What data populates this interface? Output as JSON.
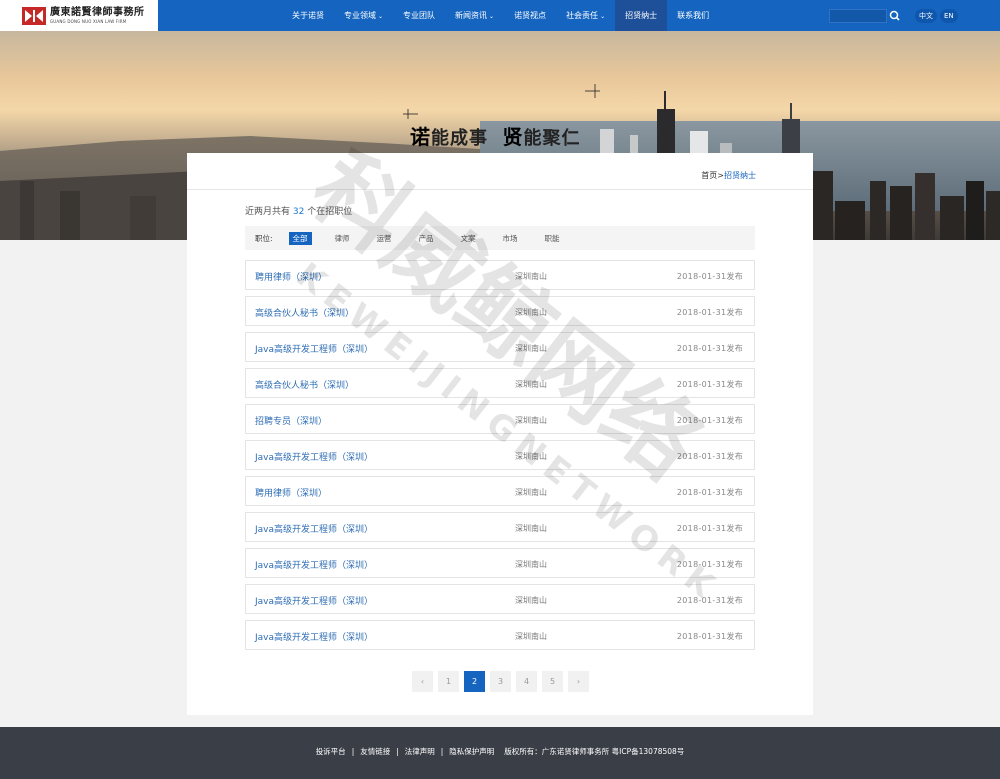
{
  "header": {
    "logo_cn": "廣東諾賢律師事務所",
    "logo_en": "GUANG DONG NUO XIAN LAW FIRM",
    "nav": [
      {
        "label": "关于诺贤",
        "caret": false,
        "active": false
      },
      {
        "label": "专业领域",
        "caret": true,
        "active": false
      },
      {
        "label": "专业团队",
        "caret": false,
        "active": false
      },
      {
        "label": "新闻资讯",
        "caret": true,
        "active": false
      },
      {
        "label": "诺贤视点",
        "caret": false,
        "active": false
      },
      {
        "label": "社会责任",
        "caret": true,
        "active": false
      },
      {
        "label": "招贤纳士",
        "caret": false,
        "active": true
      },
      {
        "label": "联系我们",
        "caret": false,
        "active": false
      }
    ],
    "lang_cn": "中文",
    "lang_en": "EN",
    "brand_color": "#1565c0"
  },
  "banner": {
    "title_a_bold": "诺",
    "title_a": "能成事",
    "title_b_bold": "贤",
    "title_b": "能聚仁"
  },
  "breadcrumb": {
    "home": "首页",
    "sep": ">",
    "current": "招贤纳士"
  },
  "summary": {
    "prefix": "近两月共有",
    "count": "32",
    "suffix": "个在招职位"
  },
  "filter": {
    "label": "职位:",
    "items": [
      "全部",
      "律师",
      "运营",
      "产品",
      "文案",
      "市场",
      "职能"
    ],
    "active": "全部"
  },
  "jobs": [
    {
      "title": "聘用律师（深圳）",
      "location": "深圳南山",
      "date": "2018-01-31发布"
    },
    {
      "title": "高级合伙人秘书（深圳）",
      "location": "深圳南山",
      "date": "2018-01-31发布"
    },
    {
      "title": "Java高级开发工程师（深圳）",
      "location": "深圳南山",
      "date": "2018-01-31发布"
    },
    {
      "title": "高级合伙人秘书（深圳）",
      "location": "深圳南山",
      "date": "2018-01-31发布"
    },
    {
      "title": "招聘专员（深圳）",
      "location": "深圳南山",
      "date": "2018-01-31发布"
    },
    {
      "title": "Java高级开发工程师（深圳）",
      "location": "深圳南山",
      "date": "2018-01-31发布"
    },
    {
      "title": "聘用律师（深圳）",
      "location": "深圳南山",
      "date": "2018-01-31发布"
    },
    {
      "title": "Java高级开发工程师（深圳）",
      "location": "深圳南山",
      "date": "2018-01-31发布"
    },
    {
      "title": "Java高级开发工程师（深圳）",
      "location": "深圳南山",
      "date": "2018-01-31发布"
    },
    {
      "title": "Java高级开发工程师（深圳）",
      "location": "深圳南山",
      "date": "2018-01-31发布"
    },
    {
      "title": "Java高级开发工程师（深圳）",
      "location": "深圳南山",
      "date": "2018-01-31发布"
    }
  ],
  "pagination": {
    "prev_icon": "chevron-left-icon",
    "pages": [
      "1",
      "2",
      "3",
      "4",
      "5"
    ],
    "current": "2",
    "next_icon": "chevron-right-icon"
  },
  "footer": {
    "links": [
      "投诉平台",
      "友情链接",
      "法律声明",
      "隐私保护声明"
    ],
    "copyright": "版权所有：广东诺贤律师事务所  粤ICP备13078508号"
  },
  "watermark": {
    "cn": "科威鲸网络",
    "en": "KEWEIJINGNETWORK"
  }
}
